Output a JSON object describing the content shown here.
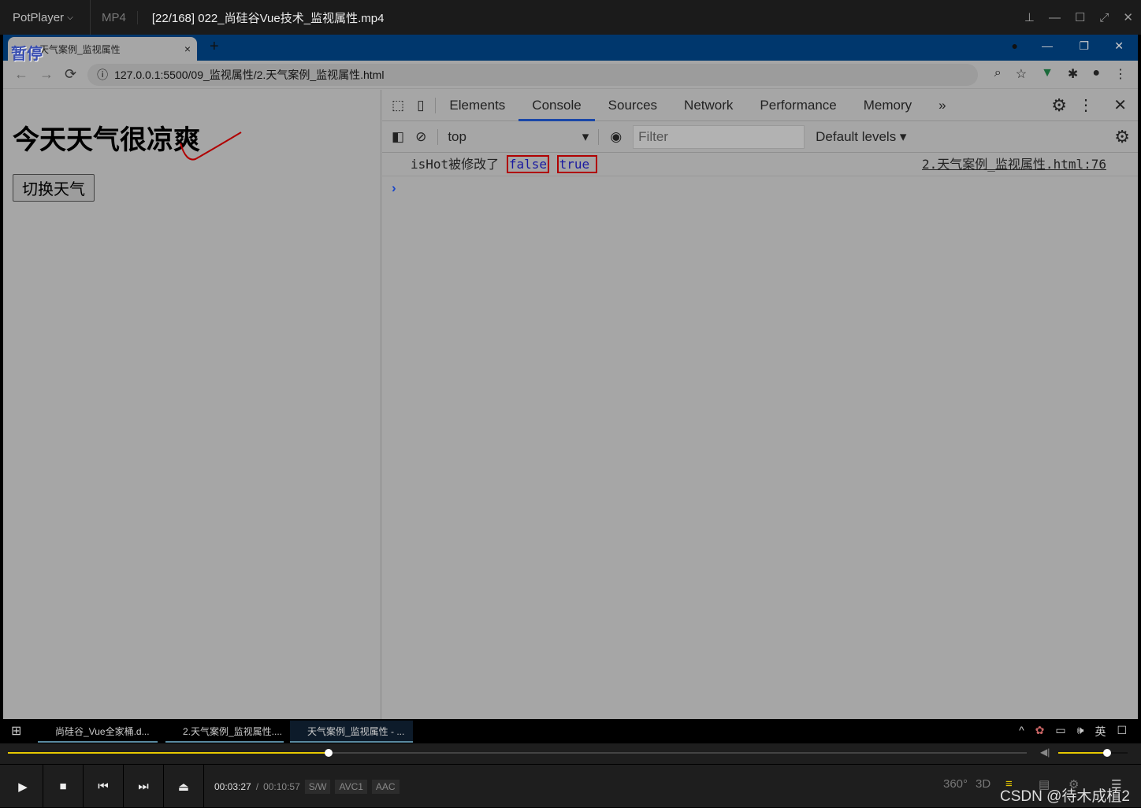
{
  "player": {
    "brand": "PotPlayer",
    "format": "MP4",
    "file_title": "[22/168] 022_尚硅谷Vue技术_监视属性.mp4",
    "paused_label": "暂停",
    "current_time": "00:03:27",
    "separator": "/",
    "total_time": "00:10:57",
    "badges": [
      "S/W",
      "AVC1",
      "AAC"
    ],
    "progress_percent": 31.5,
    "volume_percent": 70,
    "accent": "#e6c800",
    "right_buttons": [
      "360°",
      "3D"
    ]
  },
  "browser": {
    "tab_title": "天气案例_监视属性",
    "tab_close": "×",
    "new_tab": "+",
    "url": "127.0.0.1:5500/09_监视属性/2.天气案例_监视属性.html"
  },
  "page": {
    "heading": "今天天气很凉爽",
    "button": "切换天气"
  },
  "devtools": {
    "tabs": [
      "Elements",
      "Console",
      "Sources",
      "Network",
      "Performance",
      "Memory"
    ],
    "more": "»",
    "context": "top",
    "filter_placeholder": "Filter",
    "levels": "Default levels ▾",
    "log": {
      "text": "isHot被修改了",
      "values": [
        "false",
        "true"
      ],
      "source": "2.天气案例_监视属性.html:76"
    },
    "prompt": "›"
  },
  "taskbar": {
    "items": [
      "尚硅谷_Vue全家桶.d...",
      "2.天气案例_监视属性....",
      "天气案例_监视属性 - ..."
    ],
    "ime": "英"
  },
  "watermark": "CSDN @待木成植2"
}
